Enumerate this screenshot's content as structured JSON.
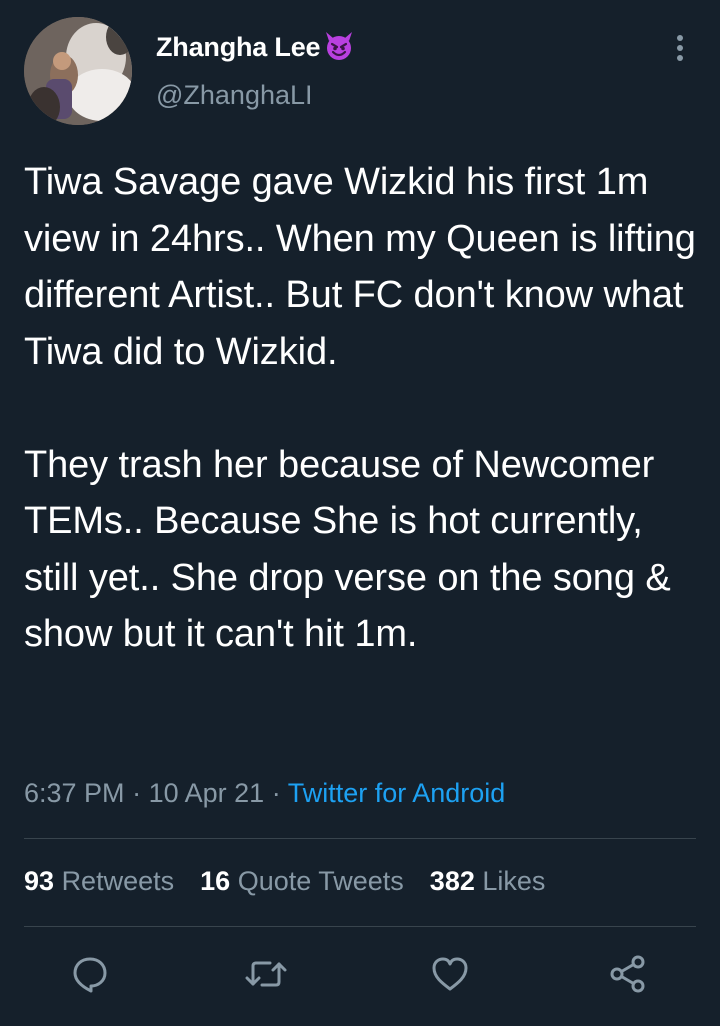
{
  "author": {
    "display_name": "Zhangha Lee",
    "emoji": "😈",
    "handle": "@ZhanghaLI"
  },
  "tweet": {
    "text": "Tiwa Savage gave Wizkid his first 1m view in 24hrs.. When my Queen is lifting different Artist.. But FC don't know what Tiwa did to Wizkid.\n\nThey trash her because of Newcomer TEMs.. Because She is hot currently, still yet.. She drop verse on the song & show but it can't hit 1m.",
    "time": "6:37 PM",
    "date": "10 Apr 21",
    "separator": "·",
    "source": "Twitter for Android"
  },
  "stats": {
    "retweets_count": "93",
    "retweets_label": "Retweets",
    "quote_count": "16",
    "quote_label": "Quote Tweets",
    "likes_count": "382",
    "likes_label": "Likes"
  },
  "icons": {
    "more": "more-vertical-icon",
    "reply": "reply-icon",
    "retweet": "retweet-icon",
    "like": "heart-icon",
    "share": "share-icon"
  },
  "colors": {
    "background": "#15202b",
    "text": "#ffffff",
    "secondary": "#8899a6",
    "accent": "#1da1f2",
    "divider": "#38444d",
    "emoji": "#b940e0"
  }
}
